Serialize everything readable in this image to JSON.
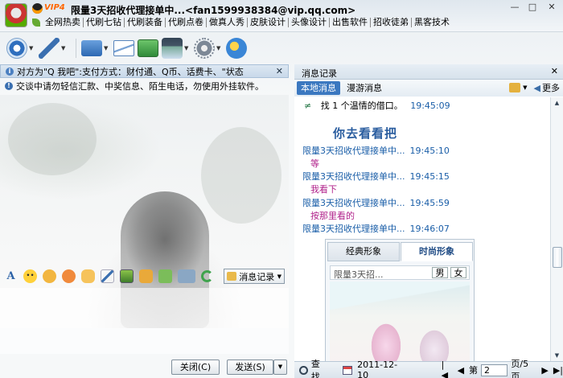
{
  "title": {
    "vip": "VIP4",
    "text": "限量3天招收代理接单中...<fan1599938384@vip.qq.com>",
    "signature_links": [
      "全网热卖",
      "代刷七钻",
      "代刷装备",
      "代刷点卷",
      "做真人秀",
      "皮肤设计",
      "头像设计",
      "出售软件",
      "招收徒弟",
      "黑客技术"
    ],
    "window_buttons": {
      "minimize": "—",
      "maximize": "□",
      "close": "✕"
    }
  },
  "toolbar": {
    "icons": [
      "video-call-icon",
      "voice-call-icon",
      "file-transfer-icon",
      "mail-icon",
      "app-icon",
      "remote-assist-icon",
      "settings-icon",
      "qzone-icon"
    ]
  },
  "left": {
    "notice": "对方为\"Q 我吧\":支付方式：财付通、Q币、话费卡、\"状态",
    "warning": "交谈中请勿轻信汇款、中奖信息、陌生电话，勿使用外挂软件。",
    "history_button": "消息记录",
    "close_button": "关闭(C)",
    "send_button": "发送(S)"
  },
  "right": {
    "header": "消息记录",
    "tabs": [
      "本地消息",
      "漫游消息"
    ],
    "more": "更多",
    "messages": [
      {
        "type": "text",
        "text": "找 1 个温情的借口。",
        "time": "19:45:09"
      },
      {
        "type": "big",
        "text": "你去看看把"
      },
      {
        "type": "meta",
        "sender": "限量3天招收代理接单中...",
        "time": "19:45:10"
      },
      {
        "type": "body",
        "text": "等"
      },
      {
        "type": "meta",
        "sender": "限量3天招收代理接单中...",
        "time": "19:45:15"
      },
      {
        "type": "body",
        "text": "我看下"
      },
      {
        "type": "meta",
        "sender": "限量3天招收代理接单中...",
        "time": "19:45:59"
      },
      {
        "type": "body",
        "text": "按那里看的"
      },
      {
        "type": "meta",
        "sender": "限量3天招收代理接单中...",
        "time": "19:46:07"
      }
    ],
    "card": {
      "tabs": [
        "经典形象",
        "时尚形象"
      ],
      "name": "限量3天招...",
      "gender_male": "男",
      "gender_female": "女"
    },
    "footer": {
      "search": "查找",
      "date": "2011-12-10",
      "page_prefix": "第",
      "page": "2",
      "page_suffix": "页/5页"
    }
  },
  "colors": {
    "accent": "#3b78c0",
    "pink_text": "#b0208a",
    "link_blue": "#1a5ea8"
  }
}
